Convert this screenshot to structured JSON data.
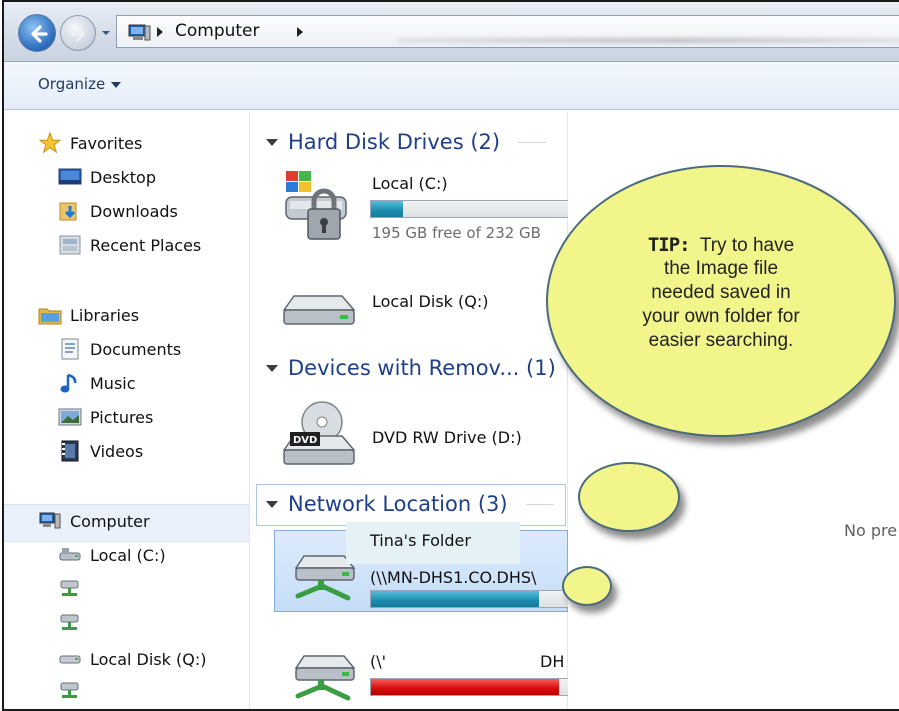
{
  "address_bar": {
    "breadcrumb": "Computer",
    "back_icon": "back-arrow-icon",
    "forward_icon": "forward-arrow-icon"
  },
  "toolbar": {
    "organize_label": "Organize"
  },
  "nav_pane": {
    "favorites": {
      "label": "Favorites",
      "items": [
        "Desktop",
        "Downloads",
        "Recent Places"
      ]
    },
    "libraries": {
      "label": "Libraries",
      "items": [
        "Documents",
        "Music",
        "Pictures",
        "Videos"
      ]
    },
    "computer": {
      "label": "Computer",
      "items": [
        "Local (C:)",
        "",
        "",
        "Local Disk (Q:)",
        ""
      ]
    }
  },
  "content": {
    "groups": {
      "hard_disk": "Hard Disk Drives (2)",
      "removable": "Devices with Remov... (1)",
      "network": "Network Location (3)"
    },
    "drives": {
      "c": {
        "name": "Local (C:)",
        "free": "195 GB free of 232 GB",
        "used_fraction": 0.16
      },
      "q": {
        "name": "Local Disk (Q:)"
      },
      "d": {
        "name": "DVD RW Drive (D:)",
        "badge": "DVD"
      },
      "net1": {
        "tooltip": "Tina's Folder",
        "path": "(\\\\MN-DHS1.CO.DHS\\",
        "used_fraction": 0.85
      },
      "net2": {
        "path_start": "(\\'",
        "path_end": "DH",
        "used_fraction": 0.95
      }
    }
  },
  "preview": {
    "text": "No pre"
  },
  "callout": {
    "tip_label": "TIP:",
    "tip_text_1": "Try to have",
    "line2": "the Image file",
    "line3": "needed saved in",
    "line4": "your own folder for",
    "line5": "easier searching."
  },
  "colors": {
    "group_header": "#1e3f8a",
    "bubble_fill": "#f2f58a",
    "bar_fill": "#1c8db0",
    "bar_full": "#d40d0d"
  }
}
